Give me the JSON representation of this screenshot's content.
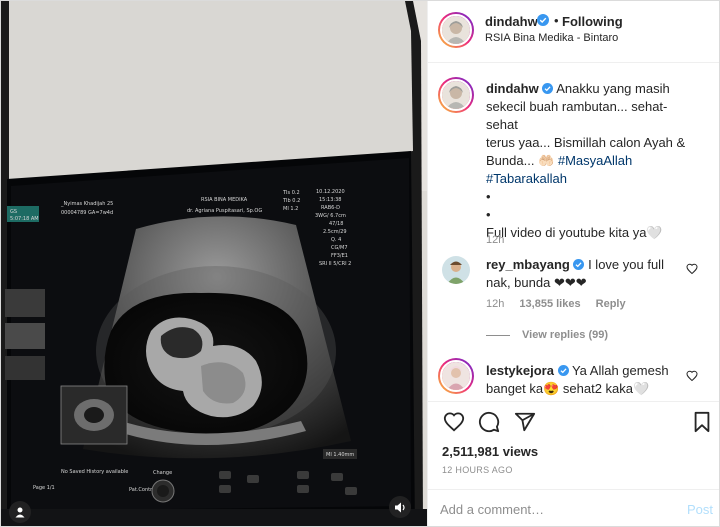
{
  "post": {
    "username": "dindahw",
    "follow_status": "Following",
    "dot": "•",
    "location": "RSIA Bina Medika - Bintaro",
    "views": "2,511,981 views",
    "time_ago": "12 HOURS AGO"
  },
  "caption": {
    "username": "dindahw",
    "line1": "Anakku yang masih",
    "line2": "sekecil buah rambutan... sehat-sehat",
    "line3": "terus yaa... Bismillah calon Ayah &",
    "line4a": "Bunda... 🤲🏻 ",
    "line4b": "#MasyaAllah",
    "line5": "#Tabarakallah",
    "bullet1": "•",
    "bullet2": "•",
    "line6": "Full video di youtube kita ya🤍",
    "time": "12h"
  },
  "comments": [
    {
      "username": "rey_mbayang",
      "text_a": "I love you full",
      "text_b": "nak, bunda ❤❤❤",
      "time": "12h",
      "likes": "13,855 likes",
      "reply": "Reply",
      "view_replies": "View replies (99)"
    },
    {
      "username": "lestykejora",
      "text_a": "Ya Allah gemesh",
      "text_b": "banget ka😍 sehat2 kaka🤍"
    }
  ],
  "add_comment": {
    "placeholder": "Add a comment…",
    "post_label": "Post"
  },
  "scan_screen": {
    "hospital": "RSIA BINA MEDIKA",
    "doctor": "dr. Agriana Puspitasari, Sp.OG",
    "patient": "_Nyimas Khadijah 25",
    "patient_id": "00004789  GA=7w4d",
    "date": "10.12.2020",
    "time": "15:13:38",
    "probe": "RAB6-D",
    "mode": "3WG/ 6.7cm",
    "tis": "TIs  0.2",
    "tib": "TIb  0.2",
    "mi": "MI  1.2",
    "params": [
      "47/18",
      "2.5cm/29",
      "Q. 4",
      "CG/M7",
      "FF3/E1",
      "SRI II 5/CRI 2"
    ],
    "left_tag": "GS",
    "left_time": "5:07:18 AM",
    "bottom_note": "No Saved History available",
    "page": "Page 1/1",
    "change": "Change",
    "freeze": "Pat.Control",
    "ms_readout": "MI 1.40mm"
  },
  "colors": {
    "link": "#00376b",
    "verified": "#3897f0",
    "post_disabled": "#b2dffc",
    "meta_grey": "#8e8e8e"
  },
  "icons": [
    "verified-icon",
    "heart-icon",
    "comment-icon",
    "share-icon",
    "bookmark-icon",
    "mute-icon",
    "user-tag-icon"
  ]
}
